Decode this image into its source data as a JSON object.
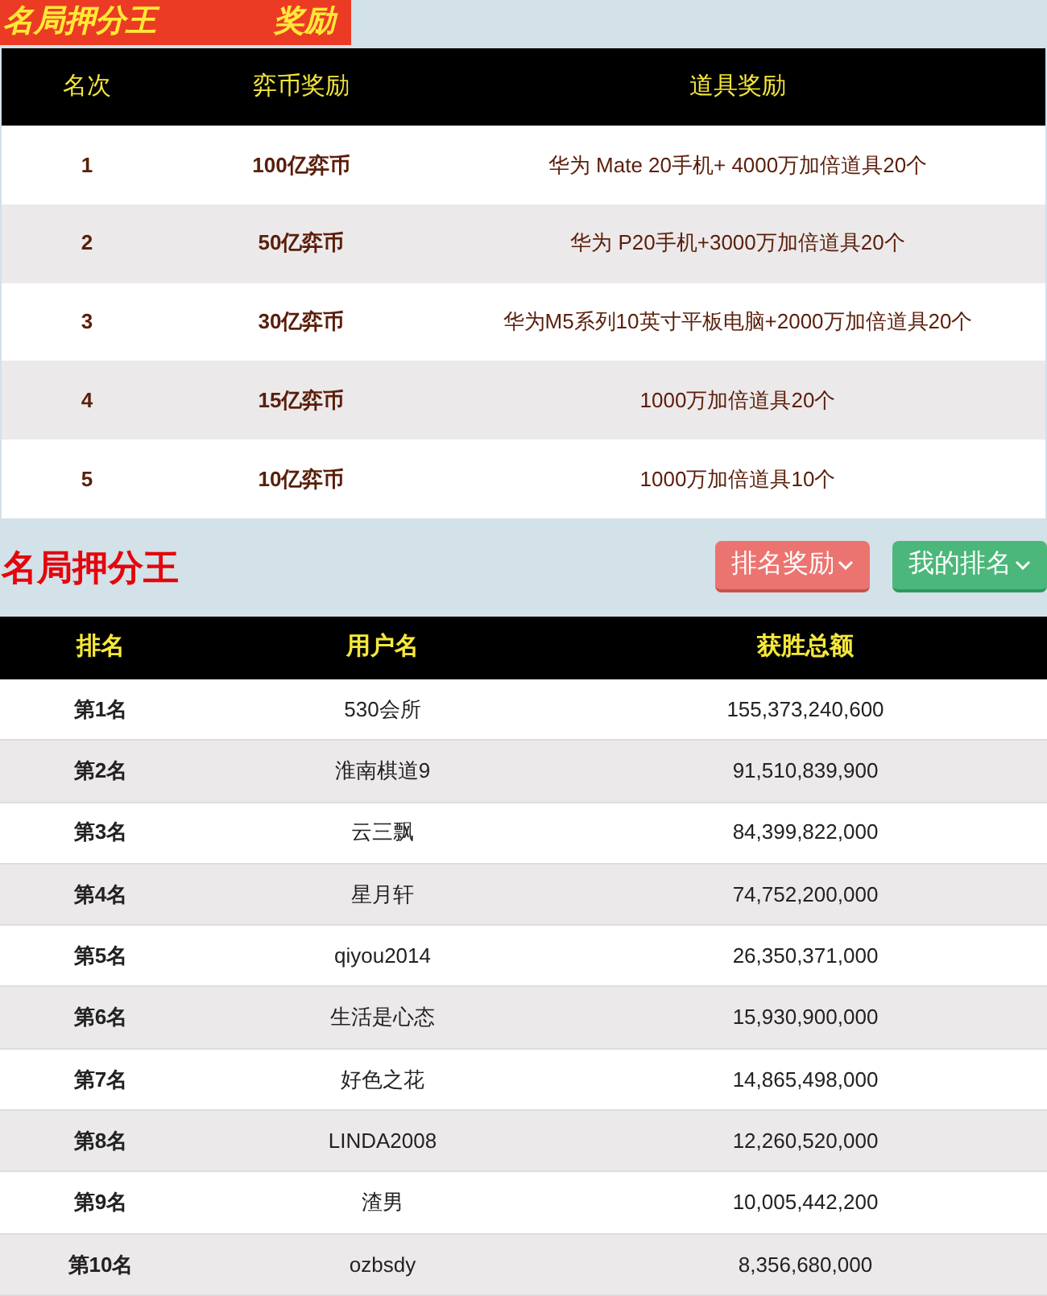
{
  "banner": {
    "title": "名局押分王",
    "subtitle": "奖励"
  },
  "reward_table": {
    "columns": [
      "名次",
      "弈币奖励",
      "道具奖励"
    ],
    "rows": [
      {
        "rank": "1",
        "coins": "100亿弈币",
        "items": "华为 Mate 20手机+ 4000万加倍道具20个"
      },
      {
        "rank": "2",
        "coins": "50亿弈币",
        "items": "华为 P20手机+3000万加倍道具20个"
      },
      {
        "rank": "3",
        "coins": "30亿弈币",
        "items": "华为M5系列10英寸平板电脑+2000万加倍道具20个"
      },
      {
        "rank": "4",
        "coins": "15亿弈币",
        "items": "1000万加倍道具20个"
      },
      {
        "rank": "5",
        "coins": "10亿弈币",
        "items": "1000万加倍道具10个"
      }
    ]
  },
  "leaderboard": {
    "title": "名局押分王",
    "buttons": [
      {
        "label": "排名奖励",
        "kind": "danger"
      },
      {
        "label": "我的排名",
        "kind": "success"
      }
    ],
    "columns": [
      "排名",
      "用户名",
      "获胜总额"
    ],
    "rows": [
      {
        "rank": "第1名",
        "user": "530会所",
        "total": "155,373,240,600"
      },
      {
        "rank": "第2名",
        "user": "淮南棋道9",
        "total": "91,510,839,900"
      },
      {
        "rank": "第3名",
        "user": "云三飘",
        "total": "84,399,822,000"
      },
      {
        "rank": "第4名",
        "user": "星月轩",
        "total": "74,752,200,000"
      },
      {
        "rank": "第5名",
        "user": "qiyou2014",
        "total": "26,350,371,000"
      },
      {
        "rank": "第6名",
        "user": "生活是心态",
        "total": "15,930,900,000"
      },
      {
        "rank": "第7名",
        "user": "好色之花",
        "total": "14,865,498,000"
      },
      {
        "rank": "第8名",
        "user": "LINDA2008",
        "total": "12,260,520,000"
      },
      {
        "rank": "第9名",
        "user": "渣男",
        "total": "10,005,442,200"
      },
      {
        "rank": "第10名",
        "user": "ozbsdy",
        "total": "8,356,680,000"
      }
    ]
  }
}
